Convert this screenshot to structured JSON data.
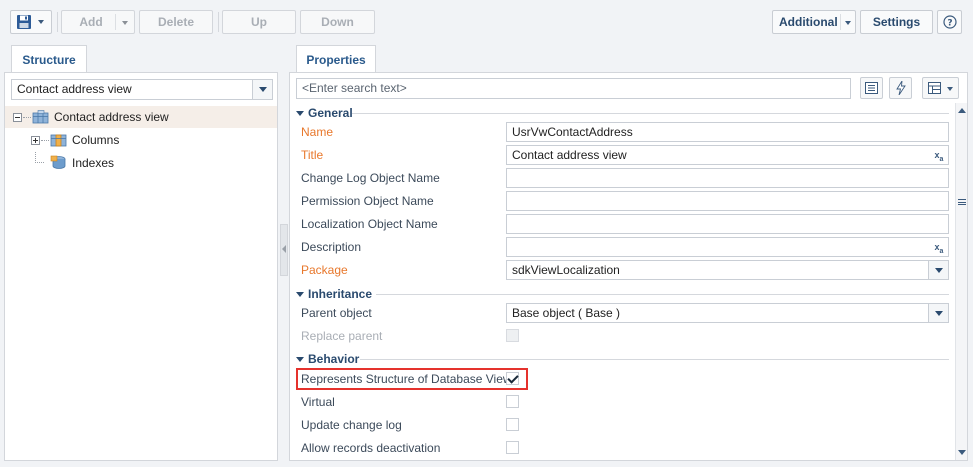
{
  "toolbar": {
    "add_label": "Add",
    "delete_label": "Delete",
    "up_label": "Up",
    "down_label": "Down",
    "additional_label": "Additional",
    "settings_label": "Settings",
    "help_icon": "question-icon"
  },
  "structure": {
    "tab_label": "Structure",
    "selector_value": "Contact address view",
    "tree": [
      {
        "label": "Contact address view",
        "selected": true,
        "level": 0
      },
      {
        "label": "Columns",
        "selected": false,
        "level": 1
      },
      {
        "label": "Indexes",
        "selected": false,
        "level": 1
      }
    ]
  },
  "properties": {
    "tab_label": "Properties",
    "search_placeholder": "<Enter search text>",
    "sections": {
      "general": "General",
      "inheritance": "Inheritance",
      "behavior": "Behavior"
    },
    "fields": {
      "name": {
        "label": "Name",
        "value": "UsrVwContactAddress"
      },
      "title": {
        "label": "Title",
        "value": "Contact address view"
      },
      "change_log": {
        "label": "Change Log Object Name",
        "value": ""
      },
      "permission": {
        "label": "Permission Object Name",
        "value": ""
      },
      "localization": {
        "label": "Localization Object Name",
        "value": ""
      },
      "description": {
        "label": "Description",
        "value": ""
      },
      "package": {
        "label": "Package",
        "value": "sdkViewLocalization"
      },
      "parent_object": {
        "label": "Parent object",
        "value": "Base object ( Base )"
      },
      "replace_parent": {
        "label": "Replace parent"
      },
      "represents_db_view": {
        "label": "Represents Structure of Database View",
        "checked": true
      },
      "virtual": {
        "label": "Virtual",
        "checked": false
      },
      "update_change_log": {
        "label": "Update change log",
        "checked": false
      },
      "allow_deactivation": {
        "label": "Allow records deactivation",
        "checked": false
      }
    }
  },
  "colors": {
    "accent": "#2a4a6e",
    "required_label": "#e8782c",
    "highlight": "#e5322d"
  }
}
